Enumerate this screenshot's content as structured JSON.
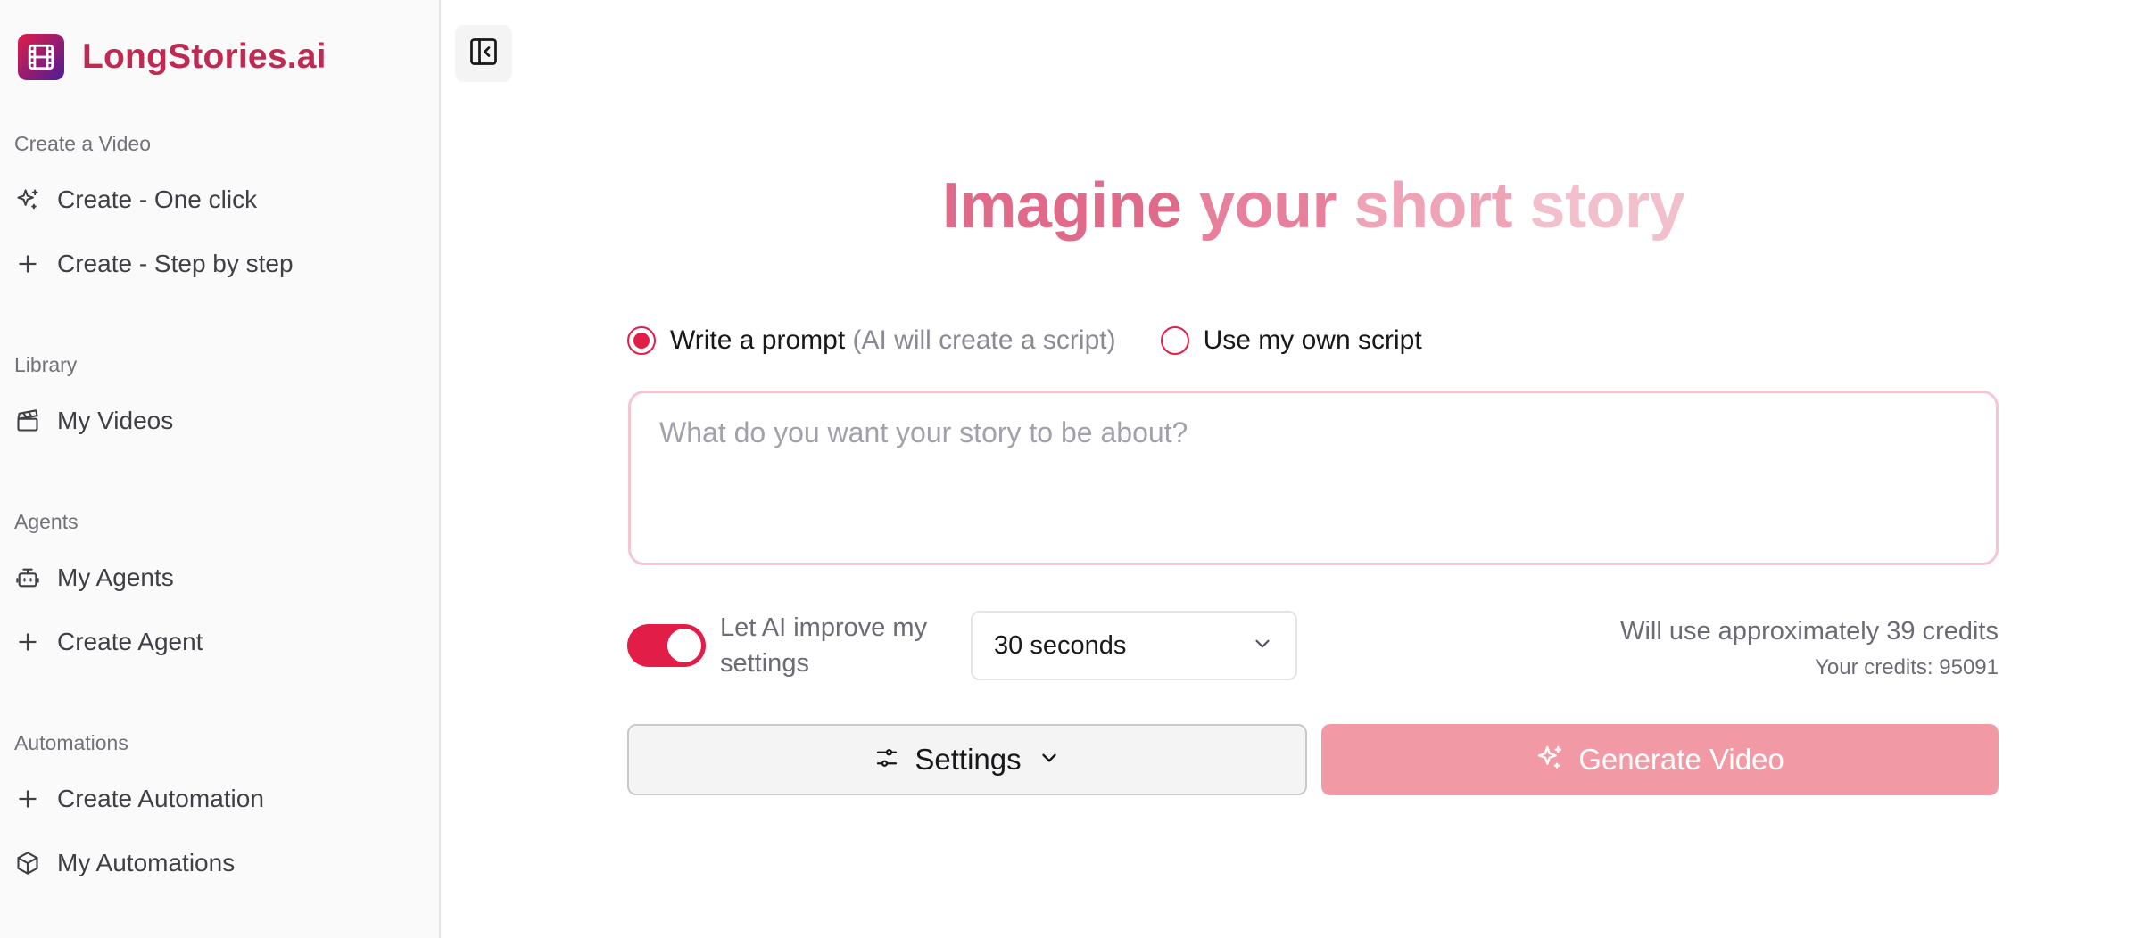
{
  "brand": {
    "name": "LongStories.ai",
    "logo_icon": "film-icon"
  },
  "sidebar": {
    "sections": [
      {
        "label": "Create a Video",
        "items": [
          {
            "label": "Create - One click",
            "icon": "sparkles-icon"
          },
          {
            "label": "Create - Step by step",
            "icon": "plus-icon"
          }
        ]
      },
      {
        "label": "Library",
        "items": [
          {
            "label": "My Videos",
            "icon": "clapperboard-icon"
          }
        ]
      },
      {
        "label": "Agents",
        "items": [
          {
            "label": "My Agents",
            "icon": "bot-icon"
          },
          {
            "label": "Create Agent",
            "icon": "plus-icon"
          }
        ]
      },
      {
        "label": "Automations",
        "items": [
          {
            "label": "Create Automation",
            "icon": "plus-icon"
          },
          {
            "label": "My Automations",
            "icon": "box-icon"
          }
        ]
      }
    ]
  },
  "main": {
    "headline": {
      "w1": "Imagine",
      "w2": "your",
      "w3": "short",
      "w4": "story"
    },
    "mode": {
      "option_prompt": "Write a prompt",
      "option_prompt_hint": "(AI will create a script)",
      "option_script": "Use my own script",
      "selected": "prompt"
    },
    "prompt": {
      "placeholder": "What do you want your story to be about?",
      "value": ""
    },
    "ai_improve": {
      "label": "Let AI improve my settings",
      "enabled": true
    },
    "duration": {
      "selected": "30 seconds"
    },
    "credits": {
      "estimate_text": "Will use approximately 39 credits",
      "balance_text": "Your credits: 95091"
    },
    "settings_button": "Settings",
    "generate_button": "Generate Video"
  },
  "colors": {
    "brand": "#be2a52",
    "accent": "#e11d48",
    "generate_button": "#f199a5",
    "prompt_border": "#f7c5d2"
  }
}
